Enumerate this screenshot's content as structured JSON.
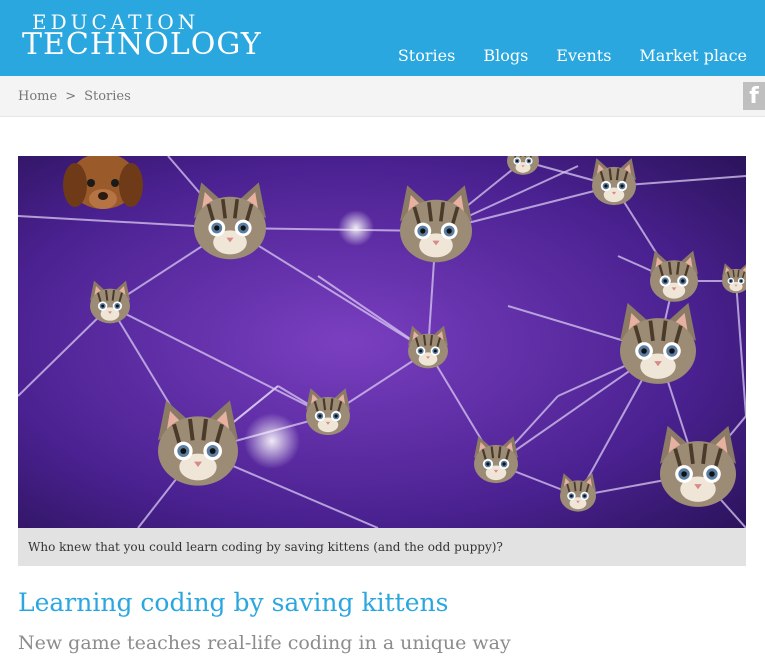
{
  "site": {
    "logo_line1": "EDUCATION",
    "logo_line2": "TECHNOLOGY",
    "brand_color": "#2aa7df"
  },
  "nav": {
    "items": [
      {
        "label": "Stories"
      },
      {
        "label": "Blogs"
      },
      {
        "label": "Events"
      },
      {
        "label": "Market place"
      }
    ]
  },
  "breadcrumb": {
    "home": "Home",
    "separator": ">",
    "current": "Stories"
  },
  "social": {
    "facebook_icon": "facebook-icon",
    "facebook_glyph": "f"
  },
  "article": {
    "image_caption": "Who knew that you could learn coding by saving kittens (and the odd puppy)?",
    "title": "Learning coding by saving kittens",
    "subtitle": "New game teaches real-life coding in a unique way"
  }
}
